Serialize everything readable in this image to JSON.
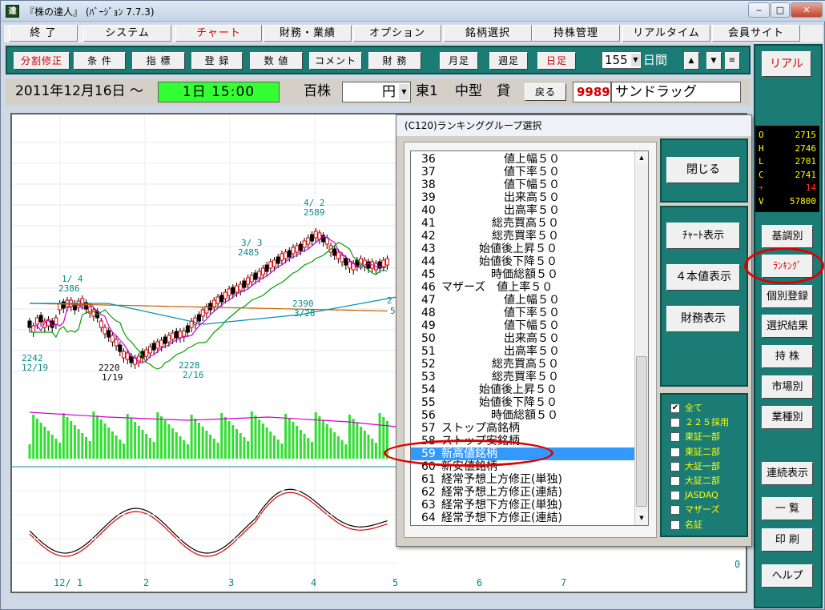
{
  "window": {
    "title": "『株の達人』 (ﾊﾞｰｼﾞｮﾝ 7.7.3)",
    "icon_glyph": "達",
    "buttons": [
      "minimize",
      "maximize",
      "close"
    ]
  },
  "menus": [
    "終 了",
    "システム",
    "チャート",
    "財務・業績",
    "オプション",
    "銘柄選択",
    "持株管理",
    "リアルタイム",
    "会員サイト"
  ],
  "toolbar": {
    "buttons": [
      "分割修正",
      "条 件",
      "指 標",
      "登 録",
      "数 値",
      "コメント",
      "財 務",
      "月足",
      "週足",
      "日足"
    ],
    "days_value": "155",
    "days_label": "日間"
  },
  "info": {
    "date": "2011年12月16日 ～",
    "time": "1日 15:00",
    "unit": "百株",
    "currency": "円",
    "market": "東1",
    "size": "中型",
    "lend": "貸",
    "back_button": "戻る",
    "code": "9989",
    "name": "サンドラッグ"
  },
  "right_panel": {
    "realtime_button": "リアル",
    "ohlc": [
      {
        "k": "O",
        "v": "2715"
      },
      {
        "k": "H",
        "v": "2746"
      },
      {
        "k": "L",
        "v": "2701"
      },
      {
        "k": "C",
        "v": "2741"
      },
      {
        "k": "+",
        "v": "14"
      },
      {
        "k": "V",
        "v": "57800"
      }
    ],
    "buttons": [
      "基調別",
      "ﾗﾝｷﾝｸﾞ",
      "個別登録",
      "選択結果",
      "持 株",
      "市場別",
      "業種別",
      "連続表示",
      "一 覧",
      "印 刷",
      "ヘルプ"
    ]
  },
  "chart": {
    "annotations": {
      "high_apr": "4/ 2",
      "high_apr_val": "2589",
      "mar3": "3/ 3",
      "mar3_val": "2485",
      "jan4": "1/ 4",
      "jan4_val": "2386",
      "mar28_val": "2390",
      "mar28": "3/28",
      "low_dec_val": "2242",
      "low_dec": "12/19",
      "low_jan_val": "2220",
      "low_jan": "1/19",
      "low_feb_val": "2228",
      "low_feb": "2/16",
      "partial_a": "2",
      "partial_b": "5"
    },
    "x_labels": [
      "12/ 1",
      "2",
      "3",
      "4",
      "5",
      "6",
      "7"
    ],
    "osc_zero": "0"
  },
  "dialog": {
    "title": "(C120)ランキンググループ選択",
    "close_button": "閉じる",
    "chart_button": "ﾁｬｰﾄ表示",
    "four_button": "４本値表示",
    "finance_button": "財務表示",
    "items": [
      {
        "n": "36",
        "t": "値上幅５０",
        "i": 1
      },
      {
        "n": "37",
        "t": "値下率５０",
        "i": 1
      },
      {
        "n": "38",
        "t": "値下幅５０",
        "i": 1
      },
      {
        "n": "39",
        "t": "出来高５０",
        "i": 2
      },
      {
        "n": "40",
        "t": "出高率５０",
        "i": 2
      },
      {
        "n": "41",
        "t": "総売買高５０",
        "i": 3
      },
      {
        "n": "42",
        "t": "総売買率５０",
        "i": 3
      },
      {
        "n": "43",
        "t": "始値後上昇５０",
        "i": 4
      },
      {
        "n": "44",
        "t": "始値後下降５０",
        "i": 4
      },
      {
        "n": "45",
        "t": "時価総額５０",
        "i": 5
      },
      {
        "n": "46",
        "t": "マザーズ　値上率５０",
        "i": 0
      },
      {
        "n": "47",
        "t": "値上幅５０",
        "i": 1
      },
      {
        "n": "48",
        "t": "値下率５０",
        "i": 1
      },
      {
        "n": "49",
        "t": "値下幅５０",
        "i": 1
      },
      {
        "n": "50",
        "t": "出来高５０",
        "i": 2
      },
      {
        "n": "51",
        "t": "出高率５０",
        "i": 2
      },
      {
        "n": "52",
        "t": "総売買高５０",
        "i": 3
      },
      {
        "n": "53",
        "t": "総売買率５０",
        "i": 3
      },
      {
        "n": "54",
        "t": "始値後上昇５０",
        "i": 4
      },
      {
        "n": "55",
        "t": "始値後下降５０",
        "i": 4
      },
      {
        "n": "56",
        "t": "時価総額５０",
        "i": 5
      },
      {
        "n": "57",
        "t": "ストップ高銘柄",
        "i": 0
      },
      {
        "n": "58",
        "t": "ストップ安銘柄",
        "i": 0
      },
      {
        "n": "59",
        "t": "新高値銘柄",
        "i": 0
      },
      {
        "n": "60",
        "t": "新安値銘柄",
        "i": 0
      },
      {
        "n": "61",
        "t": "経常予想上方修正(単独)",
        "i": 0
      },
      {
        "n": "62",
        "t": "経常予想上方修正(連結)",
        "i": 0
      },
      {
        "n": "63",
        "t": "経常予想下方修正(単独)",
        "i": 0
      },
      {
        "n": "64",
        "t": "経常予想下方修正(連結)",
        "i": 0
      }
    ],
    "selected_index": 23,
    "checkboxes": [
      {
        "label": "全て",
        "checked": true
      },
      {
        "label": "２２５採用",
        "checked": false
      },
      {
        "label": "東証一部",
        "checked": false
      },
      {
        "label": "東証二部",
        "checked": false
      },
      {
        "label": "大証一部",
        "checked": false
      },
      {
        "label": "大証二部",
        "checked": false
      },
      {
        "label": "JASDAQ",
        "checked": false
      },
      {
        "label": "マザーズ",
        "checked": false
      },
      {
        "label": "名証",
        "checked": false
      }
    ]
  },
  "colors": {
    "teal": "#1a7c74",
    "highlight": "#3399ff",
    "annotation_red": "#e00000",
    "time_green": "#33ff33"
  }
}
